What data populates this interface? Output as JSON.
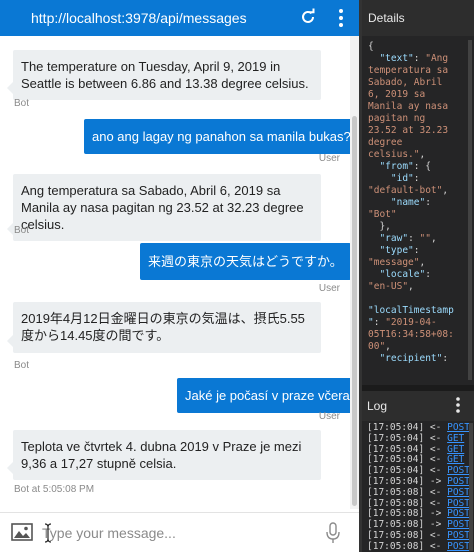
{
  "window": {
    "url": "http://localhost:3978/api/messages"
  },
  "chat": {
    "messages": [
      {
        "from": "bot",
        "text": "The temperature on Tuesday, April 9, 2019 in Seattle is between 6.86 and 13.38 degree celsius.",
        "meta": "Bot"
      },
      {
        "from": "user",
        "text": "ano ang lagay ng panahon sa manila bukas?",
        "meta": "User"
      },
      {
        "from": "bot",
        "text": "Ang temperatura sa Sabado, Abril 6, 2019 sa Manila ay nasa pagitan ng 23.52 at 32.23 degree celsius.",
        "meta": "Bot"
      },
      {
        "from": "user",
        "text": "来週の東京の天気はどうですか。",
        "meta": "User"
      },
      {
        "from": "bot",
        "text": "2019年4月12日金曜日の東京の気温は、摂氏5.55度から14.45度の間です。",
        "meta": "Bot"
      },
      {
        "from": "user",
        "text": "Jaké je počasí v praze včera",
        "meta": "User"
      },
      {
        "from": "bot",
        "text": "Teplota ve čtvrtek 4. dubna 2019 v Praze je mezi 9,36 a 17,27 stupně celsia.",
        "meta": "Bot at 5:05:08 PM"
      }
    ],
    "input_placeholder": "Type your message..."
  },
  "details": {
    "title": "Details",
    "json_lines": [
      [
        [
          "p",
          "{"
        ]
      ],
      [
        [
          "p",
          "  "
        ],
        [
          "k",
          "\"text\""
        ],
        [
          "p",
          ": "
        ],
        [
          "s",
          "\"Ang"
        ]
      ],
      [
        [
          "s",
          "temperatura sa"
        ]
      ],
      [
        [
          "s",
          "Sabado, Abril"
        ]
      ],
      [
        [
          "s",
          "6, 2019 sa"
        ]
      ],
      [
        [
          "s",
          "Manila ay nasa"
        ]
      ],
      [
        [
          "s",
          "pagitan ng"
        ]
      ],
      [
        [
          "s",
          "23.52 at 32.23"
        ]
      ],
      [
        [
          "s",
          "degree"
        ]
      ],
      [
        [
          "s",
          "celsius.\""
        ],
        [
          "p",
          ","
        ]
      ],
      [
        [
          "p",
          "  "
        ],
        [
          "k",
          "\"from\""
        ],
        [
          "p",
          ": {"
        ]
      ],
      [
        [
          "p",
          "    "
        ],
        [
          "k",
          "\"id\""
        ],
        [
          "p",
          ":"
        ]
      ],
      [
        [
          "s",
          "\"default-bot\""
        ],
        [
          "p",
          ","
        ]
      ],
      [
        [
          "p",
          "    "
        ],
        [
          "k",
          "\"name\""
        ],
        [
          "p",
          ":"
        ]
      ],
      [
        [
          "s",
          "\"Bot\""
        ]
      ],
      [
        [
          "p",
          "  },"
        ]
      ],
      [
        [
          "p",
          "  "
        ],
        [
          "k",
          "\"raw\""
        ],
        [
          "p",
          ": "
        ],
        [
          "s",
          "\"\""
        ],
        [
          "p",
          ","
        ]
      ],
      [
        [
          "p",
          "  "
        ],
        [
          "k",
          "\"type\""
        ],
        [
          "p",
          ":"
        ]
      ],
      [
        [
          "s",
          "\"message\""
        ],
        [
          "p",
          ","
        ]
      ],
      [
        [
          "p",
          "  "
        ],
        [
          "k",
          "\"locale\""
        ],
        [
          "p",
          ":"
        ]
      ],
      [
        [
          "s",
          "\"en-US\""
        ],
        [
          "p",
          ","
        ]
      ],
      [
        [
          "p",
          ""
        ]
      ],
      [
        [
          "k",
          "\"localTimestamp"
        ]
      ],
      [
        [
          "k",
          "\""
        ],
        [
          "p",
          ": "
        ],
        [
          "s",
          "\"2019-04-"
        ]
      ],
      [
        [
          "s",
          "05T16:34:58+08:"
        ]
      ],
      [
        [
          "s",
          "00\""
        ],
        [
          "p",
          ","
        ]
      ],
      [
        [
          "p",
          "  "
        ],
        [
          "k",
          "\"recipient\""
        ],
        [
          "p",
          ":"
        ]
      ]
    ]
  },
  "log": {
    "title": "Log",
    "lines": [
      {
        "time": "[17:05:04]",
        "dir": "<-",
        "method": "POST"
      },
      {
        "time": "[17:05:04]",
        "dir": "<-",
        "method": "GET"
      },
      {
        "time": "[17:05:04]",
        "dir": "<-",
        "method": "GET"
      },
      {
        "time": "[17:05:04]",
        "dir": "<-",
        "method": "GET"
      },
      {
        "time": "[17:05:04]",
        "dir": "<-",
        "method": "POST"
      },
      {
        "time": "[17:05:04]",
        "dir": "->",
        "method": "POST"
      },
      {
        "time": "[17:05:08]",
        "dir": "<-",
        "method": "POST"
      },
      {
        "time": "[17:05:08]",
        "dir": "<-",
        "method": "POST"
      },
      {
        "time": "[17:05:08]",
        "dir": "->",
        "method": "POST"
      },
      {
        "time": "[17:05:08]",
        "dir": "->",
        "method": "POST"
      },
      {
        "time": "[17:05:08]",
        "dir": "<-",
        "method": "POST"
      },
      {
        "time": "[17:05:08]",
        "dir": "<-",
        "method": "POST"
      }
    ]
  },
  "colors": {
    "accent": "#0a78d4",
    "bot_bubble": "#eceff1",
    "inspector_bg": "#252526",
    "json_key": "#9cdcfe",
    "json_string": "#ce9178",
    "log_link": "#3794ff"
  },
  "icons": {
    "refresh": "refresh-icon",
    "menu": "more-vertical-icon",
    "image": "image-icon",
    "mic": "microphone-icon"
  }
}
